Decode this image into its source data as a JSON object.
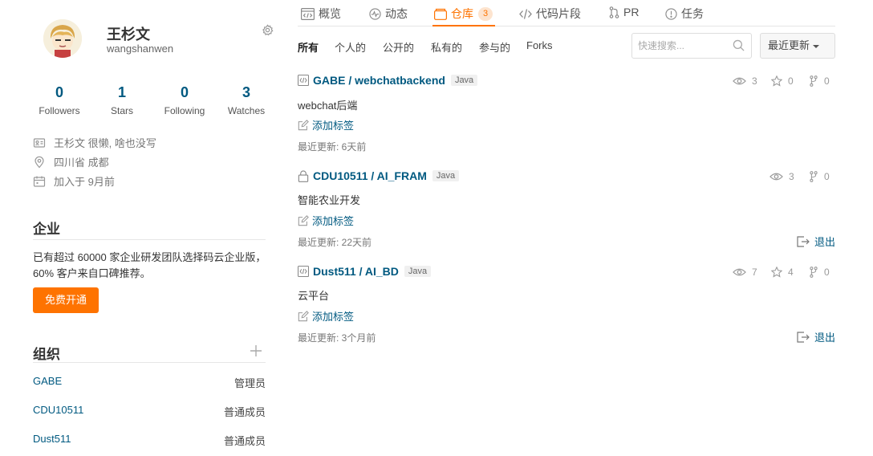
{
  "profile": {
    "display_name": "王杉文",
    "login": "wangshanwen",
    "bio": "王杉文 很懒, 啥也没写",
    "location": "四川省 成都",
    "joined": "加入于 9月前"
  },
  "stats": [
    {
      "value": "0",
      "label": "Followers"
    },
    {
      "value": "1",
      "label": "Stars"
    },
    {
      "value": "0",
      "label": "Following"
    },
    {
      "value": "3",
      "label": "Watches"
    }
  ],
  "enterprise": {
    "title": "企业",
    "text": "已有超过 60000 家企业研发团队选择码云企业版，60% 客户来自口碑推荐。",
    "button": "免费开通"
  },
  "orgs": {
    "title": "组织",
    "items": [
      {
        "name": "GABE",
        "role": "管理员"
      },
      {
        "name": "CDU10511",
        "role": "普通成员"
      },
      {
        "name": "Dust511",
        "role": "普通成员"
      }
    ]
  },
  "nav": {
    "tabs": [
      {
        "label": "概览",
        "icon": "overview-icon"
      },
      {
        "label": "动态",
        "icon": "activity-icon"
      },
      {
        "label": "仓库",
        "icon": "repo-icon",
        "badge": "3"
      },
      {
        "label": "代码片段",
        "icon": "code-icon"
      },
      {
        "label": "PR",
        "icon": "pull-request-icon"
      },
      {
        "label": "任务",
        "icon": "issue-icon"
      }
    ],
    "active": "仓库"
  },
  "filters": [
    "所有",
    "个人的",
    "公开的",
    "私有的",
    "参与的",
    "Forks"
  ],
  "search": {
    "placeholder": "快速搜索..."
  },
  "sort": {
    "label": "最近更新"
  },
  "repos": [
    {
      "name": "GABE / webchatbackend",
      "lang": "Java",
      "visibility": "public",
      "description": "webchat后端",
      "add_tag": "添加标签",
      "updated": "最近更新: 6天前",
      "watches": "3",
      "stars": "0",
      "forks": "0"
    },
    {
      "name": "CDU10511 / AI_FRAM",
      "lang": "Java",
      "visibility": "private",
      "description": "智能农业开发",
      "add_tag": "添加标签",
      "updated": "最近更新: 22天前",
      "watches": "3",
      "forks": "0",
      "exit": "退出"
    },
    {
      "name": "Dust511 / AI_BD",
      "lang": "Java",
      "visibility": "public",
      "description": "云平台",
      "add_tag": "添加标签",
      "updated": "最近更新: 3个月前",
      "watches": "7",
      "stars": "4",
      "forks": "0",
      "exit": "退出"
    }
  ],
  "colors": {
    "accent": "#fe7300",
    "link": "#005980"
  }
}
